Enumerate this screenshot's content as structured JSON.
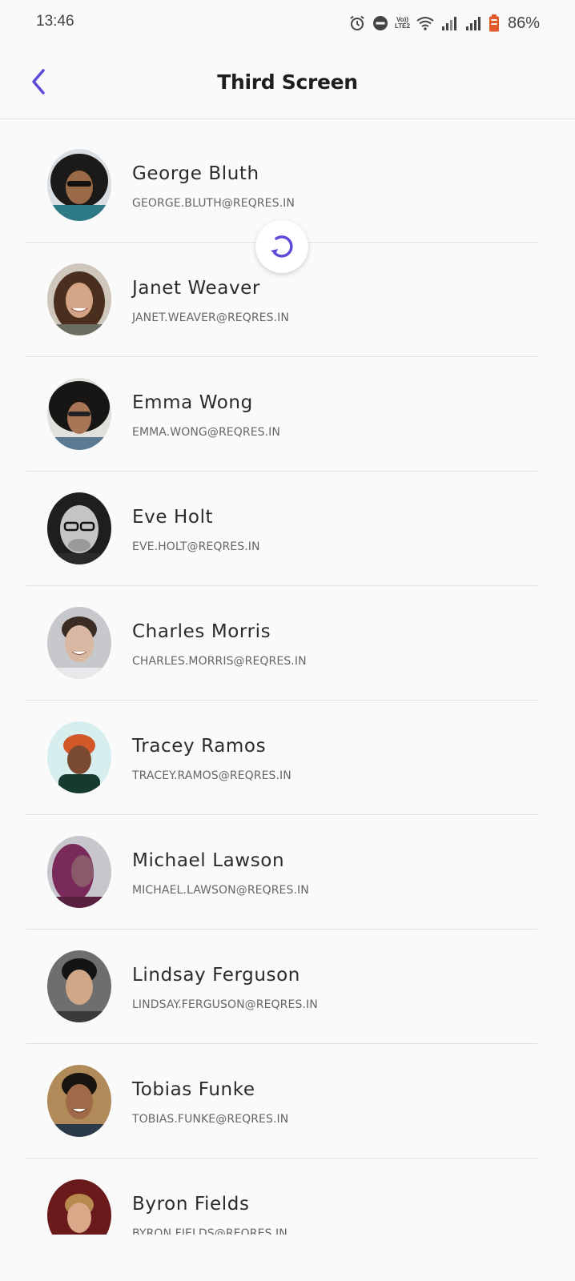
{
  "status_bar": {
    "time": "13:46",
    "volte_label_1": "Vo))",
    "volte_label_2": "LTE2",
    "battery_percent": "86%"
  },
  "header": {
    "title": "Third Screen",
    "back_icon": "chevron-left-icon"
  },
  "accent_color": "#5b4bd6",
  "refresh_icon": "refresh-icon",
  "users": [
    {
      "name": "George Bluth",
      "email": "GEORGE.BLUTH@REQRES.IN"
    },
    {
      "name": "Janet Weaver",
      "email": "JANET.WEAVER@REQRES.IN"
    },
    {
      "name": "Emma Wong",
      "email": "EMMA.WONG@REQRES.IN"
    },
    {
      "name": "Eve Holt",
      "email": "EVE.HOLT@REQRES.IN"
    },
    {
      "name": "Charles Morris",
      "email": "CHARLES.MORRIS@REQRES.IN"
    },
    {
      "name": "Tracey Ramos",
      "email": "TRACEY.RAMOS@REQRES.IN"
    },
    {
      "name": "Michael Lawson",
      "email": "MICHAEL.LAWSON@REQRES.IN"
    },
    {
      "name": "Lindsay Ferguson",
      "email": "LINDSAY.FERGUSON@REQRES.IN"
    },
    {
      "name": "Tobias Funke",
      "email": "TOBIAS.FUNKE@REQRES.IN"
    },
    {
      "name": "Byron Fields",
      "email": "BYRON.FIELDS@REQRES.IN"
    }
  ]
}
